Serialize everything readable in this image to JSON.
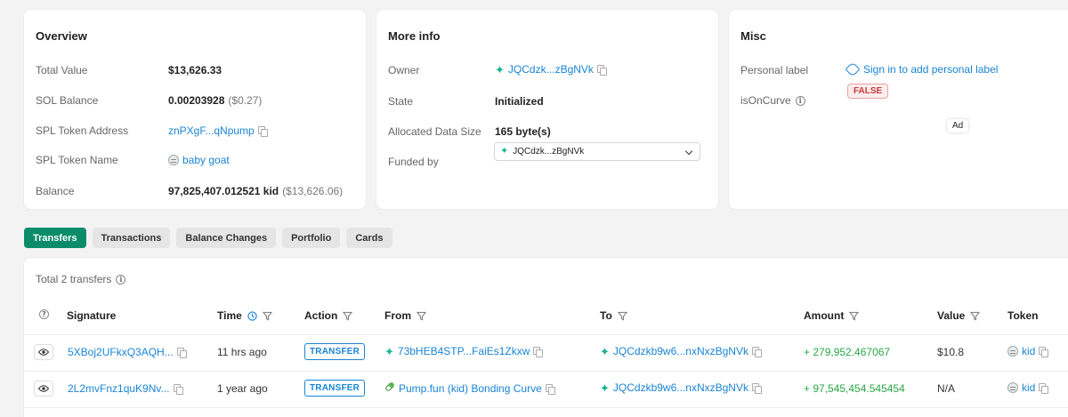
{
  "overview": {
    "title": "Overview",
    "total_value_label": "Total Value",
    "total_value": "$13,626.33",
    "sol_balance_label": "SOL Balance",
    "sol_balance": "0.00203928",
    "sol_balance_usd": "($0.27)",
    "spl_address_label": "SPL Token Address",
    "spl_address": "znPXgF...qNpump",
    "spl_name_label": "SPL Token Name",
    "spl_name": "baby goat",
    "balance_label": "Balance",
    "balance": "97,825,407.012521 kid",
    "balance_usd": "($13,626.06)"
  },
  "more_info": {
    "title": "More info",
    "owner_label": "Owner",
    "owner": "JQCdzk...zBgNVk",
    "state_label": "State",
    "state": "Initialized",
    "alloc_label": "Allocated Data Size",
    "alloc": "165 byte(s)",
    "funded_label": "Funded by",
    "funded_by": "JQCdzk...zBgNVk"
  },
  "misc": {
    "title": "Misc",
    "personal_label": "Personal label",
    "sign_in_link": "Sign in to add personal label",
    "on_curve_label": "isOnCurve",
    "on_curve_value": "FALSE",
    "ad_label": "Ad"
  },
  "tabs": [
    "Transfers",
    "Transactions",
    "Balance Changes",
    "Portfolio",
    "Cards"
  ],
  "table": {
    "total_text": "Total 2 transfers",
    "headers": {
      "signature": "Signature",
      "time": "Time",
      "action": "Action",
      "from": "From",
      "to": "To",
      "amount": "Amount",
      "value": "Value",
      "token": "Token"
    },
    "rows": [
      {
        "signature": "5XBoj2UFkxQ3AQH...",
        "time": "11 hrs ago",
        "action": "TRANSFER",
        "from": "73bHEB4STP...FaiEs1Zkxw",
        "to": "JQCdzkb9w6...nxNxzBgNVk",
        "amount": "+ 279,952.467067",
        "value": "$10.8",
        "token": "kid"
      },
      {
        "signature": "2L2mvFnz1quK9Nv...",
        "time": "1 year ago",
        "action": "TRANSFER",
        "from": "Pump.fun (kid) Bonding Curve",
        "to": "JQCdzkb9w6...nxNxzBgNVk",
        "amount": "+ 97,545,454.545454",
        "value": "N/A",
        "token": "kid"
      }
    ]
  },
  "colors": {
    "accent": "#0a8c6a",
    "link": "#1a84d4",
    "positive": "#28a745",
    "false_badge": "#c83a3a"
  }
}
